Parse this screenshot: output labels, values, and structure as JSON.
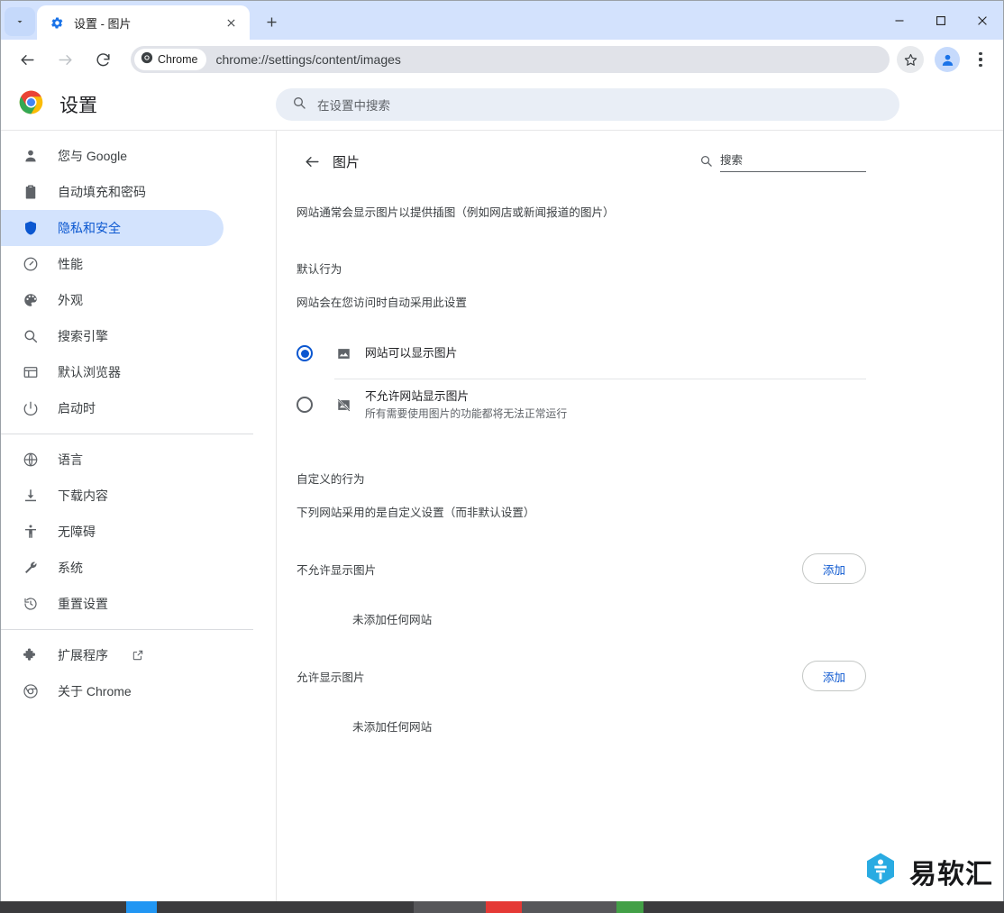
{
  "window": {
    "tab": {
      "title": "设置 - 图片",
      "favicon": "gear-icon"
    },
    "controls": {
      "minimize": "—",
      "maximize": "□",
      "close": "✕"
    },
    "tab_list_icon": "chevron-down-icon",
    "new_tab_icon": "plus-icon"
  },
  "toolbar": {
    "back_icon": "arrow-left-icon",
    "forward_icon": "arrow-right-icon",
    "reload_icon": "reload-icon",
    "chip_label": "Chrome",
    "chip_icon": "chrome-icon",
    "url": "chrome://settings/content/images",
    "bookmark_icon": "star-icon",
    "profile_icon": "avatar-icon",
    "menu_icon": "three-dot-menu-icon"
  },
  "settings": {
    "brand_icon": "chrome-logo-icon",
    "brand_title": "设置",
    "search": {
      "icon": "search-icon",
      "placeholder": "在设置中搜索",
      "value": ""
    }
  },
  "sidebar": {
    "groups": [
      {
        "items": [
          {
            "icon": "person-icon",
            "label": "您与 Google",
            "selected": false
          },
          {
            "icon": "clipboard-icon",
            "label": "自动填充和密码",
            "selected": false
          },
          {
            "icon": "shield-icon",
            "label": "隐私和安全",
            "selected": true
          },
          {
            "icon": "gauge-icon",
            "label": "性能",
            "selected": false
          },
          {
            "icon": "palette-icon",
            "label": "外观",
            "selected": false
          },
          {
            "icon": "search-icon",
            "label": "搜索引擎",
            "selected": false
          },
          {
            "icon": "browser-window-icon",
            "label": "默认浏览器",
            "selected": false
          },
          {
            "icon": "power-icon",
            "label": "启动时",
            "selected": false
          }
        ]
      },
      {
        "items": [
          {
            "icon": "globe-icon",
            "label": "语言",
            "selected": false
          },
          {
            "icon": "download-icon",
            "label": "下载内容",
            "selected": false
          },
          {
            "icon": "accessibility-icon",
            "label": "无障碍",
            "selected": false
          },
          {
            "icon": "wrench-icon",
            "label": "系统",
            "selected": false
          },
          {
            "icon": "history-restore-icon",
            "label": "重置设置",
            "selected": false
          }
        ]
      },
      {
        "items": [
          {
            "icon": "puzzle-icon",
            "label": "扩展程序",
            "selected": false,
            "external": true,
            "external_icon": "external-link-icon"
          },
          {
            "icon": "chrome-icon",
            "label": "关于 Chrome",
            "selected": false
          }
        ]
      }
    ]
  },
  "main": {
    "back_icon": "arrow-left-icon",
    "title": "图片",
    "inline_search": {
      "icon": "search-icon",
      "placeholder": "搜索",
      "value": "搜索"
    },
    "intro": "网站通常会显示图片以提供插图（例如网店或新闻报道的图片）",
    "default_behavior": {
      "heading": "默认行为",
      "subheading": "网站会在您访问时自动采用此设置",
      "options": [
        {
          "icon": "image-icon",
          "label": "网站可以显示图片",
          "description": "",
          "checked": true
        },
        {
          "icon": "image-blocked-icon",
          "label": "不允许网站显示图片",
          "description": "所有需要使用图片的功能都将无法正常运行",
          "checked": false
        }
      ]
    },
    "custom_behavior": {
      "heading": "自定义的行为",
      "subheading": "下列网站采用的是自定义设置（而非默认设置）",
      "sections": [
        {
          "label": "不允许显示图片",
          "add_label": "添加",
          "empty": "未添加任何网站"
        },
        {
          "label": "允许显示图片",
          "add_label": "添加",
          "empty": "未添加任何网站"
        }
      ]
    }
  },
  "watermark": {
    "text": "易软汇",
    "icon": "yiruanhui-logo-icon"
  },
  "colors": {
    "accent_blue": "#0b57d0",
    "tabstrip_blue": "#d3e2fd",
    "selected_nav_bg": "#d3e3fd",
    "omnibox_gray": "#e1e3e9",
    "watermark_blue": "#29abe2"
  }
}
